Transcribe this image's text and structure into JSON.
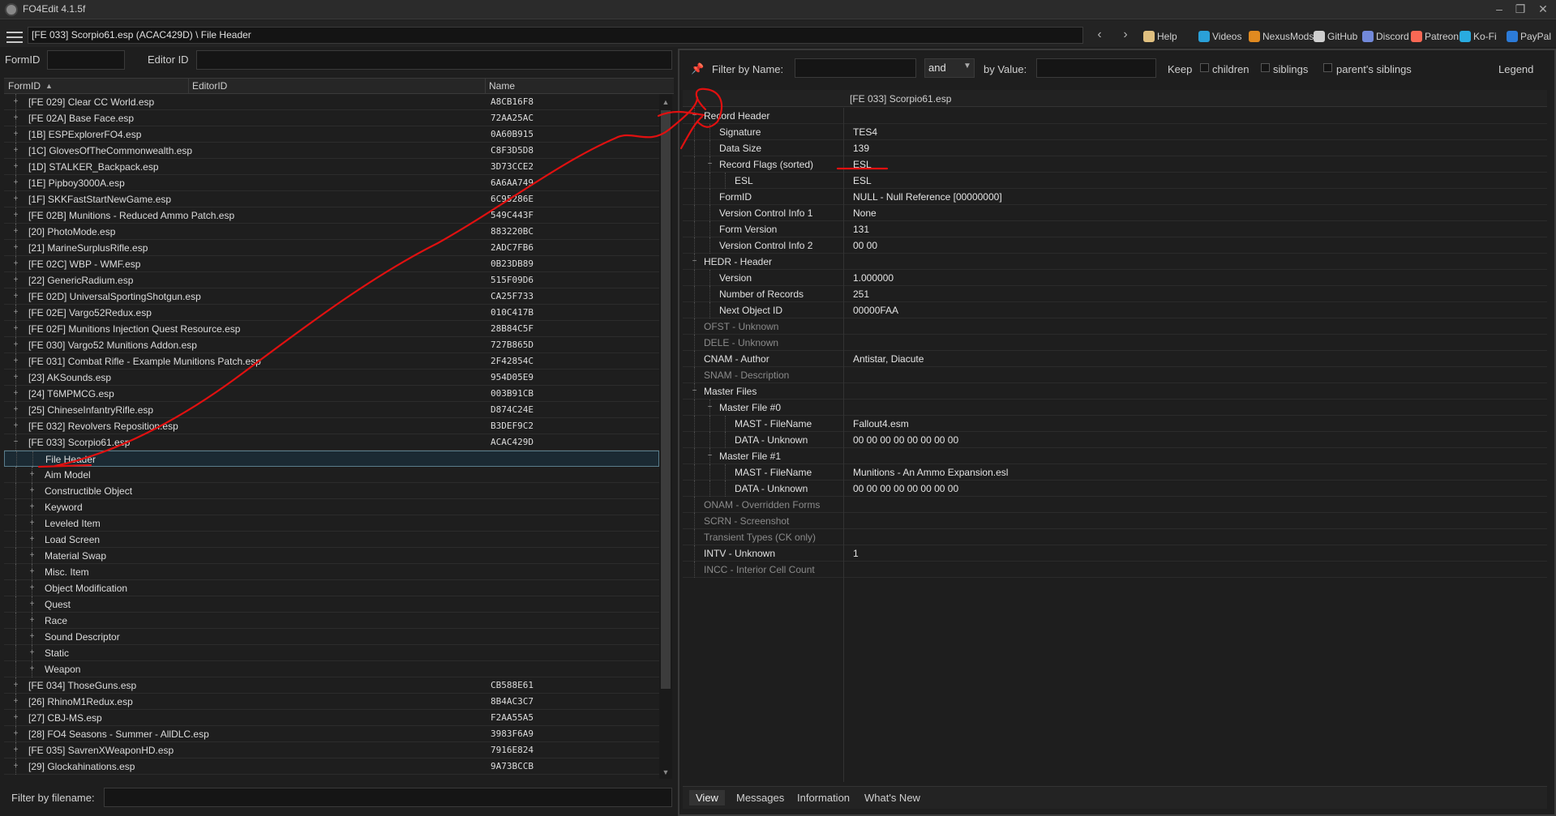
{
  "app": {
    "title": "FO4Edit 4.1.5f"
  },
  "toolbar": {
    "path": "[FE 033] Scorpio61.esp (ACAC429D) \\ File Header",
    "back": "‹",
    "forward": "›",
    "links": [
      {
        "label": "Help",
        "icon": "book-icon",
        "color": "#e0c080"
      },
      {
        "label": "Videos",
        "icon": "video-icon",
        "color": "#2aa0d8"
      },
      {
        "label": "NexusMods",
        "icon": "nexus-icon",
        "color": "#e08a20"
      },
      {
        "label": "GitHub",
        "icon": "github-icon",
        "color": "#cfcfcf"
      },
      {
        "label": "Discord",
        "icon": "discord-icon",
        "color": "#7289da"
      },
      {
        "label": "Patreon",
        "icon": "patreon-icon",
        "color": "#f96854"
      },
      {
        "label": "Ko-Fi",
        "icon": "kofi-icon",
        "color": "#29abe0"
      },
      {
        "label": "PayPal",
        "icon": "paypal-icon",
        "color": "#2c7bd8"
      }
    ]
  },
  "left": {
    "formid_label": "FormID",
    "editorid_label": "Editor ID",
    "columns": {
      "formid": "FormID",
      "editorid": "EditorID",
      "name": "Name"
    },
    "rows": [
      {
        "name": "[FE 029] Clear CC World.esp",
        "formid": "A8CB16F8",
        "level": 0,
        "expander": "+"
      },
      {
        "name": "[FE 02A] Base Face.esp",
        "formid": "72AA25AC",
        "level": 0,
        "expander": "+"
      },
      {
        "name": "[1B] ESPExplorerFO4.esp",
        "formid": "0A60B915",
        "level": 0,
        "expander": "+"
      },
      {
        "name": "[1C] GlovesOfTheCommonwealth.esp",
        "formid": "C8F3D5D8",
        "level": 0,
        "expander": "+"
      },
      {
        "name": "[1D] STALKER_Backpack.esp",
        "formid": "3D73CCE2",
        "level": 0,
        "expander": "+"
      },
      {
        "name": "[1E] Pipboy3000A.esp",
        "formid": "6A6AA749",
        "level": 0,
        "expander": "+"
      },
      {
        "name": "[1F] SKKFastStartNewGame.esp",
        "formid": "6C95286E",
        "level": 0,
        "expander": "+"
      },
      {
        "name": "[FE 02B] Munitions - Reduced Ammo Patch.esp",
        "formid": "549C443F",
        "level": 0,
        "expander": "+"
      },
      {
        "name": "[20] PhotoMode.esp",
        "formid": "883220BC",
        "level": 0,
        "expander": "+"
      },
      {
        "name": "[21] MarineSurplusRifle.esp",
        "formid": "2ADC7FB6",
        "level": 0,
        "expander": "+"
      },
      {
        "name": "[FE 02C] WBP - WMF.esp",
        "formid": "0B23DB89",
        "level": 0,
        "expander": "+"
      },
      {
        "name": "[22] GenericRadium.esp",
        "formid": "515F09D6",
        "level": 0,
        "expander": "+"
      },
      {
        "name": "[FE 02D] UniversalSportingShotgun.esp",
        "formid": "CA25F733",
        "level": 0,
        "expander": "+"
      },
      {
        "name": "[FE 02E] Vargo52Redux.esp",
        "formid": "010C417B",
        "level": 0,
        "expander": "+"
      },
      {
        "name": "[FE 02F] Munitions Injection Quest Resource.esp",
        "formid": "28B84C5F",
        "level": 0,
        "expander": "+"
      },
      {
        "name": "[FE 030] Vargo52 Munitions Addon.esp",
        "formid": "727B865D",
        "level": 0,
        "expander": "+"
      },
      {
        "name": "[FE 031] Combat Rifle - Example Munitions Patch.esp",
        "formid": "2F42854C",
        "level": 0,
        "expander": "+"
      },
      {
        "name": "[23] AKSounds.esp",
        "formid": "954D05E9",
        "level": 0,
        "expander": "+"
      },
      {
        "name": "[24] T6MPMCG.esp",
        "formid": "003B91CB",
        "level": 0,
        "expander": "+"
      },
      {
        "name": "[25] ChineseInfantryRifle.esp",
        "formid": "D874C24E",
        "level": 0,
        "expander": "+"
      },
      {
        "name": "[FE 032] Revolvers Reposition.esp",
        "formid": "B3DEF9C2",
        "level": 0,
        "expander": "+"
      },
      {
        "name": "[FE 033] Scorpio61.esp",
        "formid": "ACAC429D",
        "level": 0,
        "expander": "−"
      },
      {
        "name": "File Header",
        "formid": "",
        "level": 1,
        "expander": "",
        "selected": true
      },
      {
        "name": "Aim Model",
        "formid": "",
        "level": 1,
        "expander": "+"
      },
      {
        "name": "Constructible Object",
        "formid": "",
        "level": 1,
        "expander": "+"
      },
      {
        "name": "Keyword",
        "formid": "",
        "level": 1,
        "expander": "+"
      },
      {
        "name": "Leveled Item",
        "formid": "",
        "level": 1,
        "expander": "+"
      },
      {
        "name": "Load Screen",
        "formid": "",
        "level": 1,
        "expander": "+"
      },
      {
        "name": "Material Swap",
        "formid": "",
        "level": 1,
        "expander": "+"
      },
      {
        "name": "Misc. Item",
        "formid": "",
        "level": 1,
        "expander": "+"
      },
      {
        "name": "Object Modification",
        "formid": "",
        "level": 1,
        "expander": "+"
      },
      {
        "name": "Quest",
        "formid": "",
        "level": 1,
        "expander": "+"
      },
      {
        "name": "Race",
        "formid": "",
        "level": 1,
        "expander": "+"
      },
      {
        "name": "Sound Descriptor",
        "formid": "",
        "level": 1,
        "expander": "+"
      },
      {
        "name": "Static",
        "formid": "",
        "level": 1,
        "expander": "+"
      },
      {
        "name": "Weapon",
        "formid": "",
        "level": 1,
        "expander": "+"
      },
      {
        "name": "[FE 034] ThoseGuns.esp",
        "formid": "CB588E61",
        "level": 0,
        "expander": "+"
      },
      {
        "name": "[26] RhinoM1Redux.esp",
        "formid": "8B4AC3C7",
        "level": 0,
        "expander": "+"
      },
      {
        "name": "[27] CBJ-MS.esp",
        "formid": "F2AA55A5",
        "level": 0,
        "expander": "+"
      },
      {
        "name": "[28] FO4 Seasons - Summer - AllDLC.esp",
        "formid": "3983F6A9",
        "level": 0,
        "expander": "+"
      },
      {
        "name": "[FE 035] SavrenXWeaponHD.esp",
        "formid": "7916E824",
        "level": 0,
        "expander": "+"
      },
      {
        "name": "[29] Glockahinations.esp",
        "formid": "9A73BCCB",
        "level": 0,
        "expander": "+"
      }
    ],
    "filter_label": "Filter by filename:"
  },
  "right": {
    "filter_name_label": "Filter by Name:",
    "and_value": "and",
    "by_value_label": "by Value:",
    "keep_label": "Keep",
    "children_label": "children",
    "siblings_label": "siblings",
    "parent_siblings_label": "parent's siblings",
    "legend_label": "Legend",
    "record_header": "[FE 033] Scorpio61.esp",
    "rows": [
      {
        "label": "Record Header",
        "value": "",
        "level": 0,
        "expander": "−",
        "dim": false
      },
      {
        "label": "Signature",
        "value": "TES4",
        "level": 1,
        "expander": "",
        "dim": false
      },
      {
        "label": "Data Size",
        "value": "139",
        "level": 1,
        "expander": "",
        "dim": false
      },
      {
        "label": "Record Flags (sorted)",
        "value": "ESL",
        "level": 1,
        "expander": "−",
        "dim": false
      },
      {
        "label": "ESL",
        "value": "ESL",
        "level": 2,
        "expander": "",
        "dim": false
      },
      {
        "label": "FormID",
        "value": "NULL - Null Reference [00000000]",
        "level": 1,
        "expander": "",
        "dim": false
      },
      {
        "label": "Version Control Info 1",
        "value": "None",
        "level": 1,
        "expander": "",
        "dim": false
      },
      {
        "label": "Form Version",
        "value": "131",
        "level": 1,
        "expander": "",
        "dim": false
      },
      {
        "label": "Version Control Info 2",
        "value": "00 00",
        "level": 1,
        "expander": "",
        "dim": false
      },
      {
        "label": "HEDR - Header",
        "value": "",
        "level": 0,
        "expander": "−",
        "dim": false
      },
      {
        "label": "Version",
        "value": "1.000000",
        "level": 1,
        "expander": "",
        "dim": false
      },
      {
        "label": "Number of Records",
        "value": "251",
        "level": 1,
        "expander": "",
        "dim": false
      },
      {
        "label": "Next Object ID",
        "value": "00000FAA",
        "level": 1,
        "expander": "",
        "dim": false
      },
      {
        "label": "OFST - Unknown",
        "value": "",
        "level": 0,
        "expander": "",
        "dim": true
      },
      {
        "label": "DELE - Unknown",
        "value": "",
        "level": 0,
        "expander": "",
        "dim": true
      },
      {
        "label": "CNAM - Author",
        "value": "Antistar, Diacute",
        "level": 0,
        "expander": "",
        "dim": false
      },
      {
        "label": "SNAM - Description",
        "value": "",
        "level": 0,
        "expander": "",
        "dim": true
      },
      {
        "label": "Master Files",
        "value": "",
        "level": 0,
        "expander": "−",
        "dim": false
      },
      {
        "label": "Master File #0",
        "value": "",
        "level": 1,
        "expander": "−",
        "dim": false
      },
      {
        "label": "MAST - FileName",
        "value": "Fallout4.esm",
        "level": 2,
        "expander": "",
        "dim": false
      },
      {
        "label": "DATA - Unknown",
        "value": "00 00 00 00 00 00 00 00",
        "level": 2,
        "expander": "",
        "dim": false
      },
      {
        "label": "Master File #1",
        "value": "",
        "level": 1,
        "expander": "−",
        "dim": false
      },
      {
        "label": "MAST - FileName",
        "value": "Munitions - An Ammo Expansion.esl",
        "level": 2,
        "expander": "",
        "dim": false
      },
      {
        "label": "DATA - Unknown",
        "value": "00 00 00 00 00 00 00 00",
        "level": 2,
        "expander": "",
        "dim": false
      },
      {
        "label": "ONAM - Overridden Forms",
        "value": "",
        "level": 0,
        "expander": "",
        "dim": true
      },
      {
        "label": "SCRN - Screenshot",
        "value": "",
        "level": 0,
        "expander": "",
        "dim": true
      },
      {
        "label": "Transient Types (CK only)",
        "value": "",
        "level": 0,
        "expander": "",
        "dim": true
      },
      {
        "label": "INTV - Unknown",
        "value": "1",
        "level": 0,
        "expander": "",
        "dim": false
      },
      {
        "label": "INCC - Interior Cell Count",
        "value": "",
        "level": 0,
        "expander": "",
        "dim": true
      }
    ],
    "tabs": [
      "View",
      "Messages",
      "Information",
      "What's New"
    ],
    "active_tab": "View"
  },
  "colors": {
    "annotation": "#e01010",
    "selection_border": "#5a7d8c",
    "dim_text": "#8a8a8a"
  }
}
